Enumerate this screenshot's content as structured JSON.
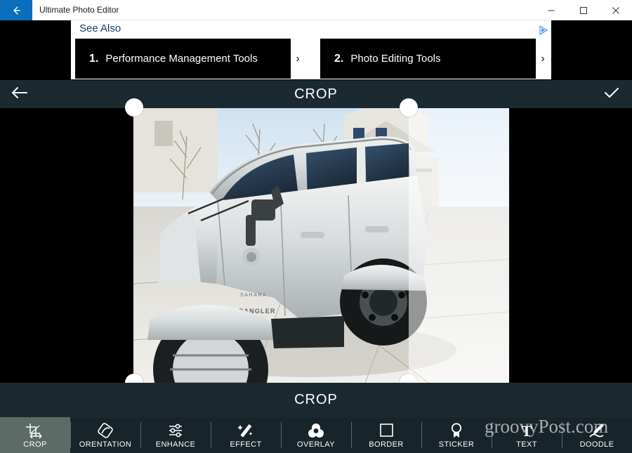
{
  "window": {
    "title": "Ultimate Photo Editor",
    "back_icon": "back-arrow-icon",
    "minimize_label": "–",
    "maximize_label": "☐",
    "close_label": "✕"
  },
  "ad": {
    "heading": "See Also",
    "adchoices_icon": "adchoices-icon",
    "items": [
      {
        "number": "1.",
        "label": "Performance Management Tools",
        "arrow": "›"
      },
      {
        "number": "2.",
        "label": "Photo Editing Tools",
        "arrow": "›"
      }
    ]
  },
  "editor_header": {
    "title": "CROP",
    "back_icon": "back-arrow-icon",
    "done_icon": "checkmark-icon"
  },
  "editor_footer": {
    "title": "CROP"
  },
  "canvas": {
    "photo_description": "Silver Jeep Wrangler Unlimited Sahara parked on a driveway",
    "handles": [
      "top-left",
      "top-right",
      "bottom-left",
      "bottom-right"
    ]
  },
  "toolbar": {
    "items": [
      {
        "label": "CROP",
        "icon": "crop-icon",
        "active": true
      },
      {
        "label": "ORENTATION",
        "icon": "orientation-icon",
        "active": false
      },
      {
        "label": "ENHANCE",
        "icon": "sliders-icon",
        "active": false
      },
      {
        "label": "EFFECT",
        "icon": "magic-wand-icon",
        "active": false
      },
      {
        "label": "OVERLAY",
        "icon": "overlay-icon",
        "active": false
      },
      {
        "label": "BORDER",
        "icon": "border-icon",
        "active": false
      },
      {
        "label": "STICKER",
        "icon": "sticker-icon",
        "active": false
      },
      {
        "label": "TEXT",
        "icon": "text-icon",
        "active": false
      },
      {
        "label": "DOODLE",
        "icon": "doodle-icon",
        "active": false
      }
    ]
  },
  "watermark": {
    "text": "groovyPost.com"
  },
  "colors": {
    "titlebar_bg": "#ffffff",
    "back_button_blue": "#0b6ebd",
    "editor_bar": "#1b2a30",
    "toolbar_bg": "#17242a",
    "active_tool_bg": "#5c6b66",
    "canvas_bg": "#000000"
  }
}
